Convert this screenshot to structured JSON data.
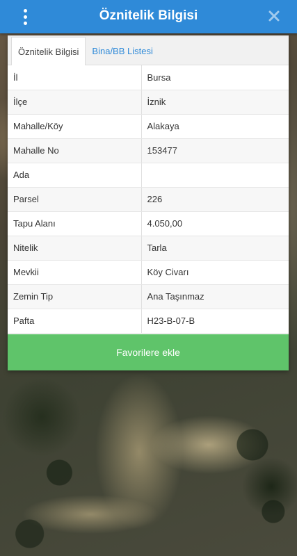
{
  "header": {
    "title": "Öznitelik Bilgisi",
    "menu_icon": "more-vertical-icon",
    "close_icon": "close-icon"
  },
  "tabs": [
    {
      "label": "Öznitelik Bilgisi",
      "active": true
    },
    {
      "label": "Bina/BB Listesi",
      "active": false
    }
  ],
  "attributes": [
    {
      "key": "İl",
      "value": "Bursa"
    },
    {
      "key": "İlçe",
      "value": "İznik"
    },
    {
      "key": "Mahalle/Köy",
      "value": "Alakaya"
    },
    {
      "key": "Mahalle No",
      "value": "153477"
    },
    {
      "key": "Ada",
      "value": ""
    },
    {
      "key": "Parsel",
      "value": "226"
    },
    {
      "key": "Tapu Alanı",
      "value": "4.050,00"
    },
    {
      "key": "Nitelik",
      "value": "Tarla"
    },
    {
      "key": "Mevkii",
      "value": "Köy Civarı"
    },
    {
      "key": "Zemin Tip",
      "value": "Ana Taşınmaz"
    },
    {
      "key": "Pafta",
      "value": "H23-B-07-B"
    }
  ],
  "actions": {
    "favorite_label": "Favorilere ekle"
  },
  "colors": {
    "header": "#2f8ad8",
    "favorite_button": "#5fc46a",
    "tab_link": "#2f8ad8"
  }
}
